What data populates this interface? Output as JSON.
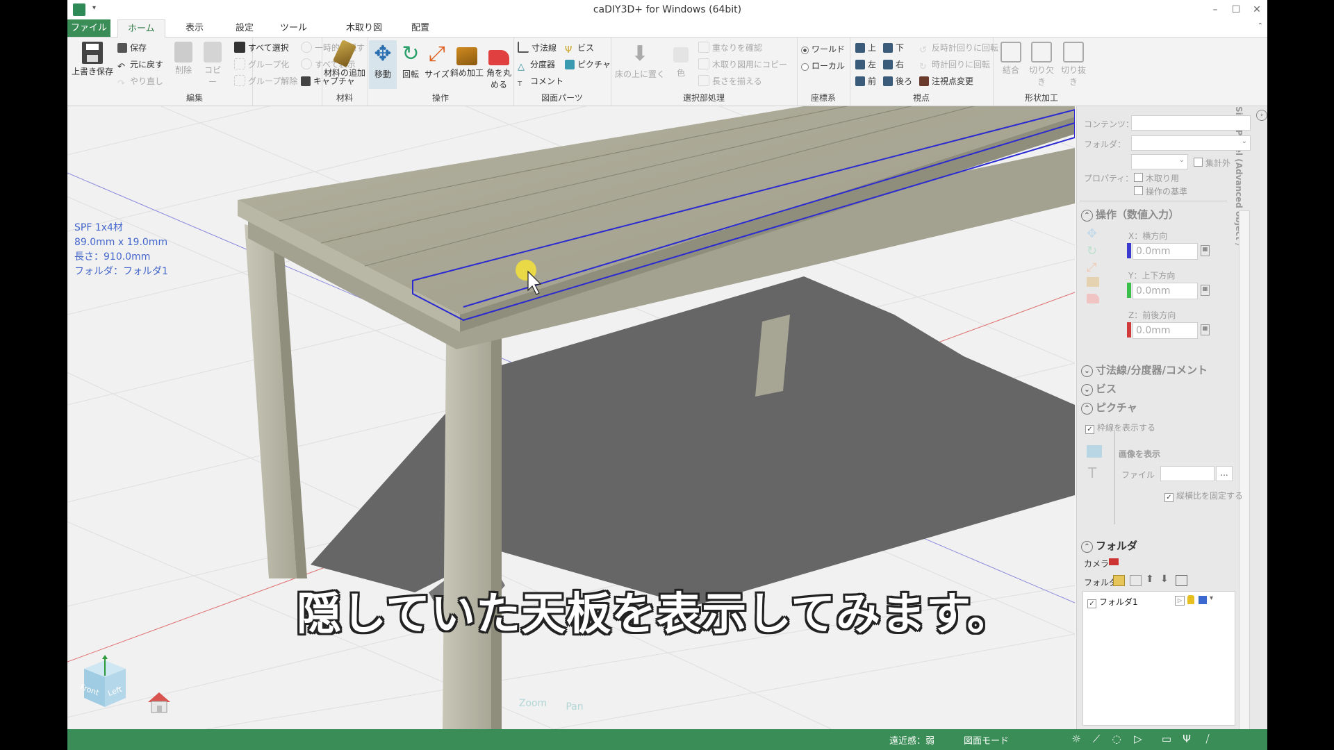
{
  "window": {
    "title": "caDIY3D+ for Windows (64bit)",
    "quick_access": "▾",
    "minimize": "–",
    "maximize": "☐",
    "close": "✕"
  },
  "tabs": [
    {
      "label": "ファイル"
    },
    {
      "label": "ホーム"
    },
    {
      "label": "表示"
    },
    {
      "label": "設定"
    },
    {
      "label": "ツール"
    },
    {
      "label": "木取り図"
    },
    {
      "label": "配置"
    }
  ],
  "ribbon": {
    "edit": {
      "label": "編集",
      "overwrite_save": "上書き保存",
      "save": "保存",
      "undo": "元に戻す",
      "redo": "やり直し",
      "delete": "削除",
      "copy": "コピー",
      "select_all": "すべて選択",
      "group": "グループ化",
      "ungroup": "グループ解除",
      "hide_temp": "一時的に隠す",
      "show_all": "すべて表示",
      "capture": "キャプチャ"
    },
    "material": {
      "label": "材料",
      "add": "材料の追加"
    },
    "operation": {
      "label": "操作",
      "move": "移動",
      "rotate": "回転",
      "size": "サイズ",
      "bevel": "斜め加工",
      "round": "角を丸める"
    },
    "parts": {
      "label": "図面パーツ",
      "dimension": "寸法線",
      "screw": "ビス",
      "divider": "分度器",
      "picture": "ピクチャ",
      "comment": "コメント"
    },
    "selection": {
      "label": "選択部処理",
      "put_floor": "床の上に置く",
      "color": "色",
      "check_overlap": "重なりを確認",
      "copy_cut": "木取り図用にコピー",
      "align_length": "長さを揃える"
    },
    "coords": {
      "label": "座標系",
      "world": "ワールド",
      "local": "ローカル"
    },
    "view": {
      "label": "視点",
      "top": "上",
      "bottom": "下",
      "left": "左",
      "right": "右",
      "front": "前",
      "back": "後ろ",
      "ccw": "反時計回りに回転",
      "cw": "時計回りに回転",
      "pivot": "注視点変更"
    },
    "shape": {
      "label": "形状加工",
      "combine": "結合",
      "notch": "切り欠き",
      "cutout": "切り抜き"
    }
  },
  "viewport": {
    "info": [
      "SPF 1x4材",
      "89.0mm x 19.0mm",
      "長さ：910.0mm",
      "フォルダ：フォルダ1"
    ],
    "subtitle": "隠していた天板を表示してみます。",
    "cube_front": "Front",
    "cube_left": "Left",
    "nav_zoom": "Zoom",
    "nav_pan": "Pan"
  },
  "side_panel": {
    "vertical_title": "Side Panel (Advanced object / Folder settings)",
    "content_label": "コンテンツ：",
    "folder_label": "フォルダ：",
    "property_label": "プロパティ：",
    "exclude_total": "集計外",
    "for_cut": "木取り用",
    "op_base": "操作の基準",
    "op_section": "操作（数値入力）",
    "x_label": "X：横方向",
    "x_value": "0.0mm",
    "y_label": "Y：上下方向",
    "y_value": "0.0mm",
    "z_label": "Z：前後方向",
    "z_value": "0.0mm",
    "dim_section": "寸法線/分度器/コメント",
    "screw_section": "ビス",
    "picture_section": "ピクチャ",
    "show_frame": "枠線を表示する",
    "show_image": "画像を表示",
    "file_label": "ファイル",
    "file_btn": "...",
    "keep_ratio": "縦横比を固定する",
    "folder_section": "フォルダ",
    "camera_label": "カメラ",
    "folder_tools_label": "フォルダ",
    "folder_item": "フォルダ1"
  },
  "status": {
    "perspective": "遠近感：弱",
    "mode": "図面モード"
  },
  "colors": {
    "accent": "#3a8d56",
    "selection": "#2a2ad0",
    "wood": "#a9a796"
  }
}
